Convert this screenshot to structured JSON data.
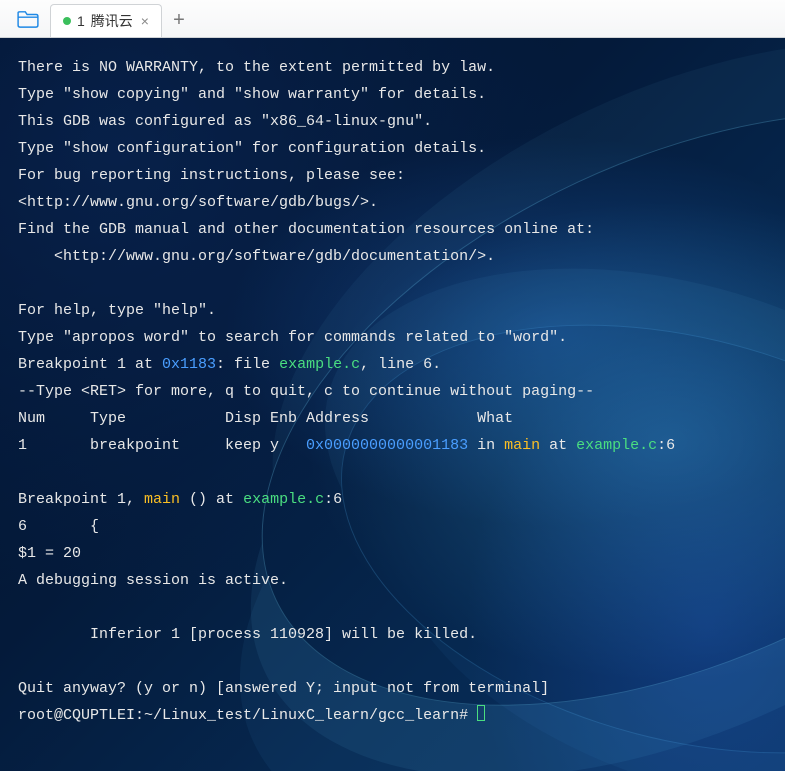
{
  "tab": {
    "index": "1",
    "title": "腾讯云",
    "modified": true
  },
  "term": {
    "l1": "There is NO WARRANTY, to the extent permitted by law.",
    "l2": "Type \"show copying\" and \"show warranty\" for details.",
    "l3": "This GDB was configured as \"x86_64-linux-gnu\".",
    "l4": "Type \"show configuration\" for configuration details.",
    "l5": "For bug reporting instructions, please see:",
    "l6": "<http://www.gnu.org/software/gdb/bugs/>.",
    "l7": "Find the GDB manual and other documentation resources online at:",
    "l8": "    <http://www.gnu.org/software/gdb/documentation/>.",
    "l9": "",
    "l10": "For help, type \"help\".",
    "l11": "Type \"apropos word\" to search for commands related to \"word\".",
    "bp_pre": "Breakpoint 1 at ",
    "bp_addr": "0x1183",
    "bp_mid": ": file ",
    "bp_file": "example.c",
    "bp_post": ", line 6.",
    "l13": "--Type <RET> for more, q to quit, c to continue without paging--",
    "hdr": "Num     Type           Disp Enb Address            What",
    "row_pre": "1       breakpoint     keep y   ",
    "row_addr": "0x0000000000001183",
    "row_in": " in ",
    "row_func": "main",
    "row_at": " at ",
    "row_file": "example.c",
    "row_post": ":6",
    "l16": "",
    "hit_pre": "Breakpoint 1, ",
    "hit_func": "main",
    "hit_mid": " () at ",
    "hit_file": "example.c",
    "hit_post": ":6",
    "l18": "6       {",
    "l19": "$1 = 20",
    "l20": "A debugging session is active.",
    "l21": "",
    "l22": "        Inferior 1 [process 110928] will be killed.",
    "l23": "",
    "l24": "Quit anyway? (y or n) [answered Y; input not from terminal]",
    "prompt": "root@CQUPTLEI:~/Linux_test/LinuxC_learn/gcc_learn# "
  }
}
